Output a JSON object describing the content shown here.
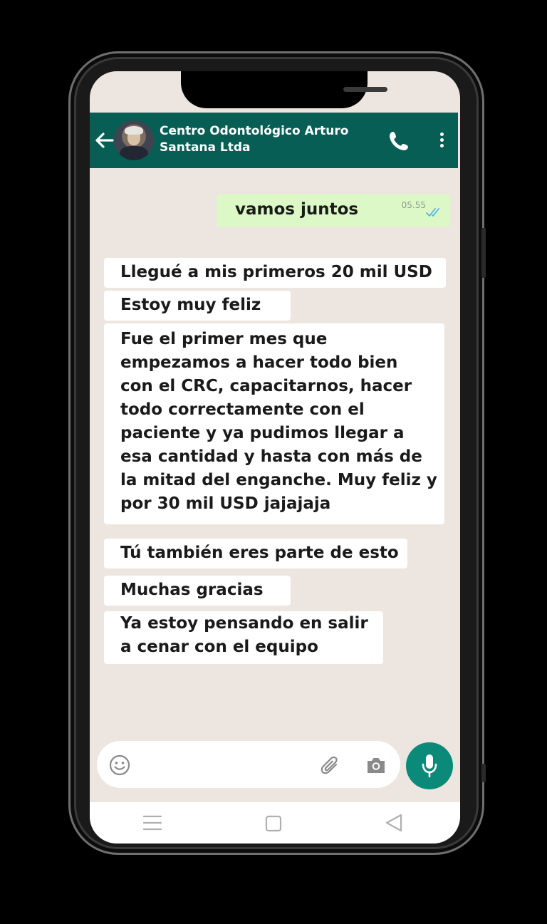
{
  "chat": {
    "contact_name": "Centro Odontológico Arturo Santana Ltda"
  },
  "messages": [
    {
      "direction": "outgoing",
      "text": "vamos juntos",
      "time": "05.55",
      "status": "read"
    },
    {
      "direction": "incoming",
      "text": "Llegué a mis primeros 20 mil USD"
    },
    {
      "direction": "incoming",
      "text": "Estoy muy feliz"
    },
    {
      "direction": "incoming",
      "lines": [
        "Fue el primer mes que",
        "empezamos a hacer todo bien",
        "con el CRC, capacitarnos, hacer",
        "todo correctamente con el",
        "paciente y ya pudimos llegar a",
        "esa cantidad y hasta con más de",
        "la mitad del enganche. Muy feliz y",
        "por 30 mil USD jajajaja"
      ]
    },
    {
      "direction": "incoming",
      "text": "Tú también eres parte de esto"
    },
    {
      "direction": "incoming",
      "text": "Muchas gracias"
    },
    {
      "direction": "incoming",
      "lines": [
        "Ya estoy pensando en salir",
        "a cenar con el equipo"
      ]
    }
  ],
  "icons": {
    "header": [
      "back-arrow-icon",
      "avatar",
      "phone-icon",
      "more-vertical-icon"
    ],
    "input": [
      "emoji-icon",
      "paperclip-icon",
      "camera-icon",
      "microphone-icon"
    ],
    "nav": [
      "recents-icon",
      "home-icon",
      "back-triangle-icon"
    ]
  },
  "colors": {
    "header": "#075e54",
    "chat_background": "#ede5df",
    "outgoing_bubble": "#dcf8c6",
    "incoming_bubble": "#ffffff",
    "mic_button": "#0b8a7a",
    "read_ticks": "#4fb6ec"
  }
}
